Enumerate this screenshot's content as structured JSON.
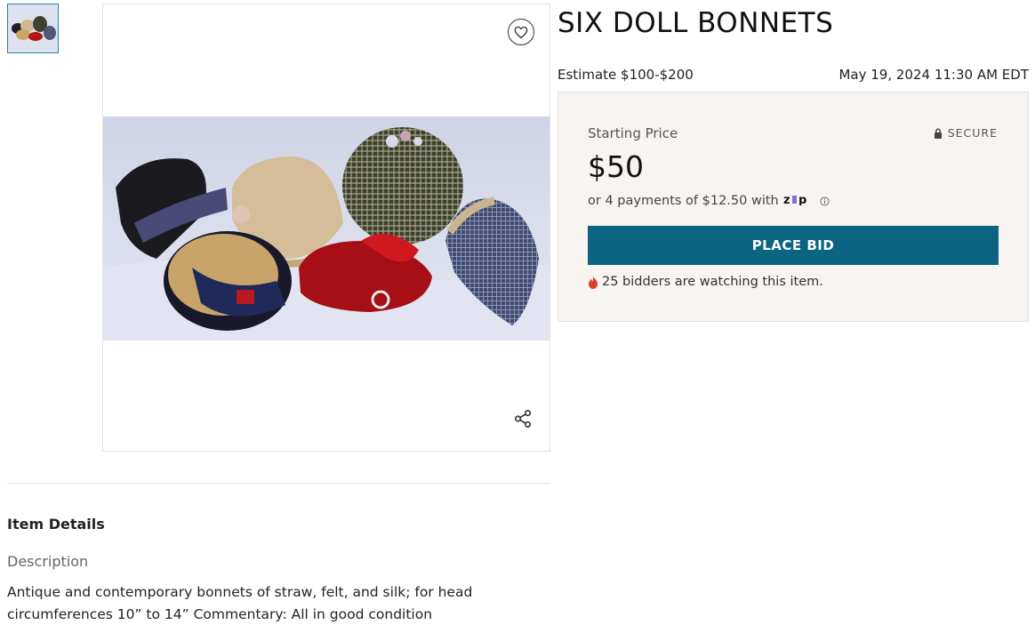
{
  "item": {
    "title": "SIX DOLL BONNETS",
    "estimate": "Estimate $100-$200",
    "datetime": "May 19, 2024 11:30 AM EDT"
  },
  "bid_box": {
    "starting_price_label": "Starting Price",
    "secure_label": "SECURE",
    "price": "$50",
    "installments_text": "or 4 payments of $12.50 with",
    "zip_logo_text": "zip",
    "place_bid_label": "PLACE BID",
    "watchers_text": "25 bidders are watching this item."
  },
  "details": {
    "heading": "Item Details",
    "description_label": "Description",
    "description_text": "Antique and contemporary bonnets of straw, felt, and silk; for head circumferences 10” to 14”   Commentary:  All in good condition"
  },
  "icons": {
    "favorite": "heart-icon",
    "share": "share-icon",
    "secure": "lock-icon",
    "info": "info-icon",
    "watchers": "flame-icon"
  },
  "colors": {
    "accent": "#0b6582",
    "bid_box_bg": "#f8f4f1",
    "flame": "#e03a2b",
    "zip_brand": "#8a6cd6"
  }
}
